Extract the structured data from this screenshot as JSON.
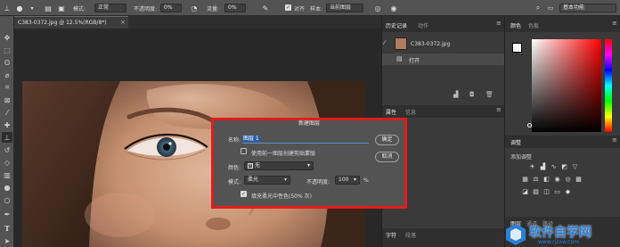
{
  "options_bar": {
    "mode_label": "模式:",
    "mode_value": "正常",
    "opacity_label": "不透明度:",
    "opacity_value": "0%",
    "flow_label": "流量:",
    "flow_value": "0%",
    "align_label": "对齐",
    "sample_label": "样本:",
    "sample_value": "当前图层",
    "workspace_value": "基本功能"
  },
  "document": {
    "tab_title": "C383-0372.jpg @ 12.5%(RGB/8*)"
  },
  "history_panel": {
    "tabs": [
      "历史记录",
      "动作"
    ],
    "snapshot_name": "C383-0372.jpg",
    "steps": [
      "打开"
    ]
  },
  "mid_lower_panel": {
    "tabs": [
      "属性",
      "信息"
    ]
  },
  "bottom_tabs": {
    "left": [
      "字符",
      "段落"
    ]
  },
  "color_panel": {
    "tabs": [
      "颜色",
      "色板"
    ]
  },
  "adjustments_panel": {
    "title": "调整",
    "add_label": "添加调整"
  },
  "layers_panel": {
    "tabs": [
      "图层",
      "通道",
      "路径"
    ]
  },
  "dialog": {
    "title": "新建图层",
    "name_label": "名称:",
    "name_value": "图层 1",
    "clip_label": "使用前一图层创建剪贴蒙版",
    "color_label": "颜色:",
    "color_value": "无",
    "mode_label": "模式:",
    "mode_value": "柔光",
    "opacity_label": "不透明度:",
    "opacity_value": "100",
    "opacity_unit": "%",
    "fill_label": "填充柔光中性色(50% 灰)",
    "fill_checked": true,
    "ok_label": "确定",
    "cancel_label": "取消"
  },
  "watermark": {
    "text": "软件自学网",
    "url": "www.rjzxw.com"
  }
}
